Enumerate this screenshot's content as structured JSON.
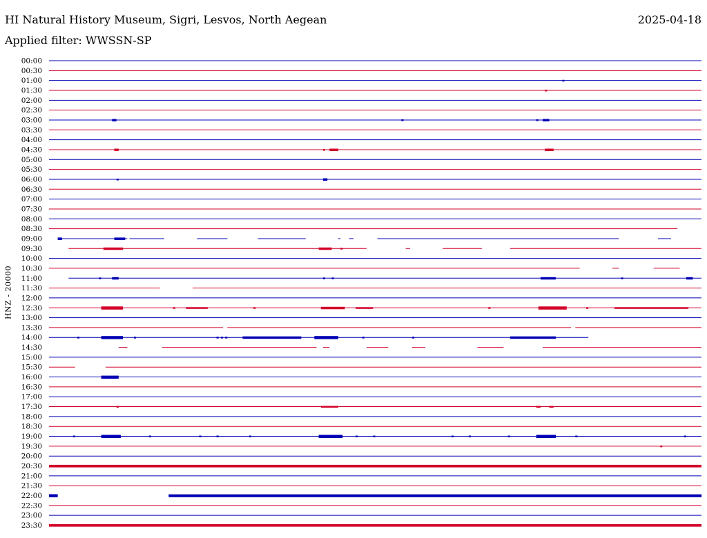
{
  "header": {
    "station": "HI Natural History Museum, Sigri, Lesvos, North Aegean",
    "date": "2025-04-18",
    "filter": "Applied filter: WWSSN-SP"
  },
  "chart_data": {
    "type": "line",
    "ylabel": "HNZ - 20000",
    "colors": {
      "odd": "#0000b4",
      "even": "#d20028"
    },
    "x_unit": "minutes after the row start time (0-30)",
    "rows": [
      {
        "t": "00:00",
        "gaps": [],
        "bursts": []
      },
      {
        "t": "00:30",
        "gaps": [],
        "bursts": []
      },
      {
        "t": "01:00",
        "gaps": [],
        "bursts": [
          [
            23.6,
            23.7,
            1
          ]
        ]
      },
      {
        "t": "01:30",
        "gaps": [],
        "bursts": [
          [
            22.8,
            22.9,
            1
          ]
        ]
      },
      {
        "t": "02:00",
        "gaps": [],
        "bursts": []
      },
      {
        "t": "02:30",
        "gaps": [],
        "bursts": []
      },
      {
        "t": "03:00",
        "gaps": [],
        "bursts": [
          [
            2.9,
            3.1,
            1.5
          ],
          [
            16.2,
            16.3,
            1
          ],
          [
            22.4,
            22.5,
            1
          ],
          [
            22.7,
            23.0,
            1.5
          ]
        ]
      },
      {
        "t": "03:30",
        "gaps": [],
        "bursts": []
      },
      {
        "t": "04:00",
        "gaps": [],
        "bursts": []
      },
      {
        "t": "04:30",
        "gaps": [],
        "bursts": [
          [
            3.0,
            3.2,
            1.5
          ],
          [
            12.6,
            12.7,
            1
          ],
          [
            12.9,
            13.3,
            1.5
          ],
          [
            22.8,
            23.2,
            1.5
          ]
        ]
      },
      {
        "t": "05:00",
        "gaps": [],
        "bursts": []
      },
      {
        "t": "05:30",
        "gaps": [],
        "bursts": []
      },
      {
        "t": "06:00",
        "gaps": [],
        "bursts": [
          [
            3.1,
            3.2,
            1
          ],
          [
            12.6,
            12.8,
            1.5
          ]
        ]
      },
      {
        "t": "06:30",
        "gaps": [],
        "bursts": []
      },
      {
        "t": "07:00",
        "gaps": [],
        "bursts": []
      },
      {
        "t": "07:30",
        "gaps": [],
        "bursts": []
      },
      {
        "t": "08:00",
        "gaps": [],
        "bursts": []
      },
      {
        "t": "08:30",
        "gaps": [
          [
            28.9,
            30
          ]
        ],
        "bursts": []
      },
      {
        "t": "09:00",
        "gaps": [
          [
            0,
            0.4
          ],
          [
            3.6,
            3.7
          ],
          [
            5.3,
            6.8
          ],
          [
            8.2,
            9.6
          ],
          [
            11.8,
            13.3
          ],
          [
            13.4,
            13.8
          ],
          [
            14.0,
            15.1
          ],
          [
            26.2,
            28.0
          ],
          [
            28.6,
            30
          ]
        ],
        "bursts": [
          [
            0.4,
            0.6,
            1.5
          ],
          [
            3.0,
            3.5,
            1.5
          ]
        ]
      },
      {
        "t": "09:30",
        "gaps": [
          [
            0,
            0.9
          ],
          [
            14.6,
            16.4
          ],
          [
            16.6,
            18.1
          ],
          [
            19.9,
            21.2
          ]
        ],
        "bursts": [
          [
            2.5,
            3.4,
            1.5
          ],
          [
            12.4,
            13.0,
            1.5
          ],
          [
            13.4,
            13.5,
            1
          ]
        ]
      },
      {
        "t": "10:00",
        "gaps": [],
        "bursts": []
      },
      {
        "t": "10:30",
        "gaps": [
          [
            24.4,
            25.9
          ],
          [
            26.2,
            27.8
          ],
          [
            29.0,
            30
          ]
        ],
        "bursts": []
      },
      {
        "t": "11:00",
        "gaps": [
          [
            0,
            0.9
          ]
        ],
        "bursts": [
          [
            2.3,
            2.4,
            1
          ],
          [
            2.9,
            3.2,
            1.5
          ],
          [
            12.6,
            12.7,
            1
          ],
          [
            13.0,
            13.1,
            1
          ],
          [
            22.6,
            23.3,
            1.5
          ],
          [
            26.3,
            26.4,
            1
          ],
          [
            29.3,
            29.6,
            1.5
          ]
        ]
      },
      {
        "t": "11:30",
        "gaps": [
          [
            5.1,
            6.6
          ]
        ],
        "bursts": []
      },
      {
        "t": "12:00",
        "gaps": [],
        "bursts": []
      },
      {
        "t": "12:30",
        "gaps": [],
        "bursts": [
          [
            2.4,
            3.4,
            2
          ],
          [
            5.7,
            5.8,
            1
          ],
          [
            6.3,
            7.3,
            1
          ],
          [
            9.4,
            9.5,
            1
          ],
          [
            12.5,
            13.6,
            1.5
          ],
          [
            14.1,
            14.9,
            1
          ],
          [
            20.2,
            20.3,
            1
          ],
          [
            22.5,
            23.8,
            2
          ],
          [
            24.7,
            24.8,
            1
          ],
          [
            26.0,
            29.4,
            1
          ]
        ]
      },
      {
        "t": "13:00",
        "gaps": [],
        "bursts": []
      },
      {
        "t": "13:30",
        "gaps": [
          [
            8.0,
            8.2
          ],
          [
            24.0,
            24.2
          ]
        ],
        "bursts": []
      },
      {
        "t": "14:00",
        "gaps": [
          [
            24.8,
            30
          ]
        ],
        "bursts": [
          [
            1.3,
            1.4,
            1
          ],
          [
            2.4,
            3.4,
            2
          ],
          [
            3.9,
            4.0,
            1
          ],
          [
            7.7,
            7.8,
            1
          ],
          [
            7.9,
            8.0,
            1
          ],
          [
            8.1,
            8.2,
            1
          ],
          [
            8.9,
            11.6,
            1.5
          ],
          [
            12.2,
            13.3,
            2
          ],
          [
            14.4,
            14.5,
            1
          ],
          [
            16.7,
            16.8,
            1
          ],
          [
            21.2,
            23.3,
            1.5
          ]
        ]
      },
      {
        "t": "14:30",
        "gaps": [
          [
            0,
            3.2
          ],
          [
            3.6,
            5.2
          ],
          [
            12.3,
            12.6
          ],
          [
            12.9,
            14.6
          ],
          [
            15.6,
            16.7
          ],
          [
            17.3,
            19.7
          ],
          [
            20.9,
            22.7
          ]
        ],
        "bursts": []
      },
      {
        "t": "15:00",
        "gaps": [],
        "bursts": []
      },
      {
        "t": "15:30",
        "gaps": [
          [
            1.2,
            2.6
          ]
        ],
        "bursts": []
      },
      {
        "t": "16:00",
        "gaps": [],
        "bursts": [
          [
            2.4,
            3.2,
            2
          ]
        ]
      },
      {
        "t": "16:30",
        "gaps": [],
        "bursts": []
      },
      {
        "t": "17:00",
        "gaps": [],
        "bursts": []
      },
      {
        "t": "17:30",
        "gaps": [],
        "bursts": [
          [
            3.1,
            3.2,
            1
          ],
          [
            12.5,
            13.3,
            1
          ],
          [
            22.4,
            22.6,
            1
          ],
          [
            23.0,
            23.2,
            1
          ]
        ]
      },
      {
        "t": "18:00",
        "gaps": [],
        "bursts": []
      },
      {
        "t": "18:30",
        "gaps": [],
        "bursts": []
      },
      {
        "t": "19:00",
        "gaps": [],
        "bursts": [
          [
            1.1,
            1.2,
            1
          ],
          [
            2.4,
            3.3,
            2
          ],
          [
            4.6,
            4.7,
            1
          ],
          [
            6.9,
            7.0,
            1
          ],
          [
            7.7,
            7.8,
            1
          ],
          [
            9.2,
            9.3,
            1
          ],
          [
            12.4,
            13.5,
            2
          ],
          [
            14.1,
            14.2,
            1
          ],
          [
            14.9,
            15.0,
            1
          ],
          [
            18.5,
            18.6,
            1
          ],
          [
            19.3,
            19.4,
            1
          ],
          [
            21.1,
            21.2,
            1
          ],
          [
            22.4,
            23.3,
            2
          ],
          [
            24.2,
            24.3,
            1
          ],
          [
            29.2,
            29.3,
            1
          ]
        ]
      },
      {
        "t": "19:30",
        "gaps": [],
        "bursts": [
          [
            28.1,
            28.2,
            1
          ]
        ]
      },
      {
        "t": "20:00",
        "gaps": [],
        "bursts": []
      },
      {
        "t": "20:30",
        "gaps": [],
        "bursts": [
          [
            0,
            30,
            1.6
          ]
        ]
      },
      {
        "t": "21:00",
        "gaps": [],
        "bursts": []
      },
      {
        "t": "21:30",
        "gaps": [],
        "bursts": []
      },
      {
        "t": "22:00",
        "gaps": [
          [
            0.4,
            5.5
          ]
        ],
        "bursts": [
          [
            0,
            0.4,
            2
          ],
          [
            5.5,
            30,
            1.8
          ]
        ]
      },
      {
        "t": "22:30",
        "gaps": [],
        "bursts": []
      },
      {
        "t": "23:00",
        "gaps": [],
        "bursts": []
      },
      {
        "t": "23:30",
        "gaps": [],
        "bursts": [
          [
            0,
            30,
            1.6
          ]
        ]
      }
    ]
  }
}
